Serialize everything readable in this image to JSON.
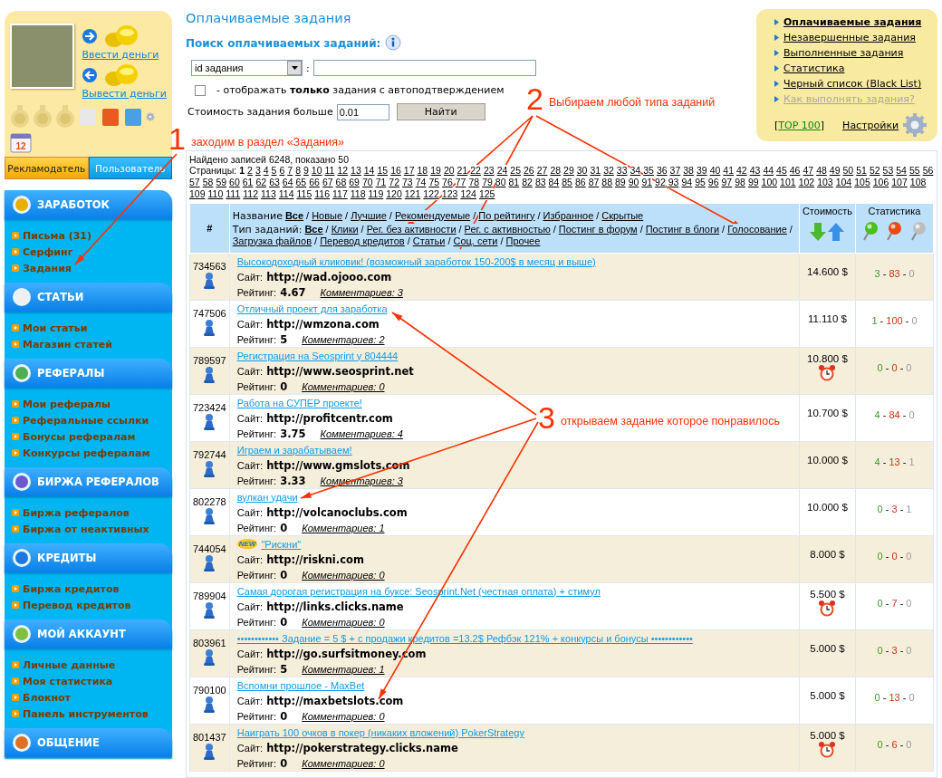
{
  "account": {
    "deposit": "Ввести деньги",
    "withdraw": "Вывести деньги",
    "calendar_day": "12",
    "tabs": [
      {
        "label": "Рекламодатель",
        "selected": false
      },
      {
        "label": "Пользователь",
        "selected": true
      }
    ]
  },
  "sidebar": [
    {
      "title": "ЗАРАБОТОК",
      "items": [
        "Письма (31)",
        "Серфинг",
        "Задания"
      ]
    },
    {
      "title": "СТАТЬИ",
      "items": [
        "Мои статьи",
        "Магазин статей"
      ]
    },
    {
      "title": "РЕФЕРАЛЫ",
      "items": [
        "Мои рефералы",
        "Реферальные ссылки",
        "Бонусы рефералам",
        "Конкурсы рефералам"
      ]
    },
    {
      "title": "БИРЖА РЕФЕРАЛОВ",
      "items": [
        "Биржа рефералов",
        "Биржа от неактивных"
      ]
    },
    {
      "title": "КРЕДИТЫ",
      "items": [
        "Биржа кредитов",
        "Перевод кредитов"
      ]
    },
    {
      "title": "МОЙ АККАУНТ",
      "items": [
        "Личные данные",
        "Моя статистика",
        "Блокнот",
        "Панель инструментов"
      ]
    },
    {
      "title": "ОБЩЕНИЕ"
    }
  ],
  "page_title": "Оплачиваемые задания",
  "search": {
    "title": "Поиск оплачиваемых заданий:",
    "select_value": "id задания",
    "colon": ":",
    "autoconfirm": {
      "label": "- отображать **только** задания с автоподтверждением",
      "checked": false
    },
    "price_label": "Стоимость задания больше",
    "price_value": "0.01",
    "button": "Найти"
  },
  "right_menu": {
    "items": [
      {
        "label": "Оплачиваемые задания",
        "selected": true,
        "kind": "link"
      },
      {
        "label": "Незавершенные задания",
        "selected": false,
        "kind": "link"
      },
      {
        "label": "Выполненные задания",
        "selected": false,
        "kind": "link"
      },
      {
        "label": "Статистика",
        "selected": false,
        "kind": "link"
      },
      {
        "label": "Черный список (Black List)",
        "selected": false,
        "kind": "link"
      },
      {
        "label": "Как выполнять задания?",
        "selected": false,
        "kind": "help"
      }
    ],
    "top_prefix": "[",
    "top_link": "TOP 100",
    "top_suffix": "]",
    "settings": "Настройки"
  },
  "results": {
    "found": "Найдено записей 6248, показано 50",
    "pages_label": "Страницы:",
    "pages": [
      {
        "label": "1",
        "selected": true
      },
      {
        "label": "2",
        "selected": false
      },
      {
        "label": "3",
        "selected": false
      },
      {
        "label": "4",
        "selected": false
      },
      {
        "label": "5",
        "selected": false
      },
      {
        "label": "6",
        "selected": false
      },
      {
        "label": "7",
        "selected": false
      },
      {
        "label": "8",
        "selected": false
      },
      {
        "label": "9",
        "selected": false
      },
      {
        "label": "10",
        "selected": false
      },
      {
        "label": "11",
        "selected": false
      },
      {
        "label": "12",
        "selected": false
      },
      {
        "label": "13",
        "selected": false
      },
      {
        "label": "14",
        "selected": false
      },
      {
        "label": "15",
        "selected": false
      },
      {
        "label": "16",
        "selected": false
      },
      {
        "label": "17",
        "selected": false
      },
      {
        "label": "18",
        "selected": false
      },
      {
        "label": "19",
        "selected": false
      },
      {
        "label": "20",
        "selected": false
      },
      {
        "label": "21",
        "selected": false
      },
      {
        "label": "22",
        "selected": false
      },
      {
        "label": "23",
        "selected": false
      },
      {
        "label": "24",
        "selected": false
      },
      {
        "label": "25",
        "selected": false
      },
      {
        "label": "26",
        "selected": false
      },
      {
        "label": "27",
        "selected": false
      },
      {
        "label": "28",
        "selected": false
      },
      {
        "label": "29",
        "selected": false
      },
      {
        "label": "30",
        "selected": false
      },
      {
        "label": "31",
        "selected": false
      },
      {
        "label": "32",
        "selected": false
      },
      {
        "label": "33",
        "selected": false
      },
      {
        "label": "34",
        "selected": false
      },
      {
        "label": "35",
        "selected": false
      },
      {
        "label": "36",
        "selected": false
      },
      {
        "label": "37",
        "selected": false
      },
      {
        "label": "38",
        "selected": false
      },
      {
        "label": "39",
        "selected": false
      },
      {
        "label": "40",
        "selected": false
      },
      {
        "label": "41",
        "selected": false
      },
      {
        "label": "42",
        "selected": false
      },
      {
        "label": "43",
        "selected": false
      },
      {
        "label": "44",
        "selected": false
      },
      {
        "label": "45",
        "selected": false
      },
      {
        "label": "46",
        "selected": false
      },
      {
        "label": "47",
        "selected": false
      },
      {
        "label": "48",
        "selected": false
      },
      {
        "label": "49",
        "selected": false
      },
      {
        "label": "50",
        "selected": false
      },
      {
        "label": "51",
        "selected": false
      },
      {
        "label": "52",
        "selected": false
      },
      {
        "label": "53",
        "selected": false
      },
      {
        "label": "54",
        "selected": false
      },
      {
        "label": "55",
        "selected": false
      },
      {
        "label": "56",
        "selected": false
      },
      {
        "label": "57",
        "selected": false
      },
      {
        "label": "58",
        "selected": false
      },
      {
        "label": "59",
        "selected": false
      },
      {
        "label": "60",
        "selected": false
      },
      {
        "label": "61",
        "selected": false
      },
      {
        "label": "62",
        "selected": false
      },
      {
        "label": "63",
        "selected": false
      },
      {
        "label": "64",
        "selected": false
      },
      {
        "label": "65",
        "selected": false
      },
      {
        "label": "66",
        "selected": false
      },
      {
        "label": "67",
        "selected": false
      },
      {
        "label": "68",
        "selected": false
      },
      {
        "label": "69",
        "selected": false
      },
      {
        "label": "70",
        "selected": false
      },
      {
        "label": "71",
        "selected": false
      },
      {
        "label": "72",
        "selected": false
      },
      {
        "label": "73",
        "selected": false
      },
      {
        "label": "74",
        "selected": false
      },
      {
        "label": "75",
        "selected": false
      },
      {
        "label": "76",
        "selected": false
      },
      {
        "label": "77",
        "selected": false
      },
      {
        "label": "78",
        "selected": false
      },
      {
        "label": "79",
        "selected": false
      },
      {
        "label": "80",
        "selected": false
      },
      {
        "label": "81",
        "selected": false
      },
      {
        "label": "82",
        "selected": false
      },
      {
        "label": "83",
        "selected": false
      },
      {
        "label": "84",
        "selected": false
      },
      {
        "label": "85",
        "selected": false
      },
      {
        "label": "86",
        "selected": false
      },
      {
        "label": "87",
        "selected": false
      },
      {
        "label": "88",
        "selected": false
      },
      {
        "label": "89",
        "selected": false
      },
      {
        "label": "90",
        "selected": false
      },
      {
        "label": "91",
        "selected": false
      },
      {
        "label": "92",
        "selected": false
      },
      {
        "label": "93",
        "selected": false
      },
      {
        "label": "94",
        "selected": false
      },
      {
        "label": "95",
        "selected": false
      },
      {
        "label": "96",
        "selected": false
      },
      {
        "label": "97",
        "selected": false
      },
      {
        "label": "98",
        "selected": false
      },
      {
        "label": "99",
        "selected": false
      },
      {
        "label": "100",
        "selected": false
      },
      {
        "label": "101",
        "selected": false
      },
      {
        "label": "102",
        "selected": false
      },
      {
        "label": "103",
        "selected": false
      },
      {
        "label": "104",
        "selected": false
      },
      {
        "label": "105",
        "selected": false
      },
      {
        "label": "106",
        "selected": false
      },
      {
        "label": "107",
        "selected": false
      },
      {
        "label": "108",
        "selected": false
      },
      {
        "label": "109",
        "selected": false
      },
      {
        "label": "110",
        "selected": false
      },
      {
        "label": "111",
        "selected": false
      },
      {
        "label": "112",
        "selected": false
      },
      {
        "label": "113",
        "selected": false
      },
      {
        "label": "114",
        "selected": false
      },
      {
        "label": "115",
        "selected": false
      },
      {
        "label": "116",
        "selected": false
      },
      {
        "label": "117",
        "selected": false
      },
      {
        "label": "118",
        "selected": false
      },
      {
        "label": "119",
        "selected": false
      },
      {
        "label": "120",
        "selected": false
      },
      {
        "label": "121",
        "selected": false
      },
      {
        "label": "122",
        "selected": false
      },
      {
        "label": "123",
        "selected": false
      },
      {
        "label": "124",
        "selected": false
      },
      {
        "label": "125",
        "selected": false
      }
    ]
  },
  "table": {
    "id_header": "#",
    "separator": "/",
    "price_header": "Стоимость",
    "stats_header": "Статистика",
    "stats_separator": "-",
    "name_filter": {
      "label": "Название",
      "items": [
        {
          "label": "Все",
          "selected": true
        },
        {
          "label": "Новые",
          "selected": false
        },
        {
          "label": "Лучшие",
          "selected": false
        },
        {
          "label": "Рекомендуемые",
          "selected": false
        },
        {
          "label": "По рейтингу",
          "selected": false
        },
        {
          "label": "Избранное",
          "selected": false
        },
        {
          "label": "Скрытые",
          "selected": false
        }
      ]
    },
    "type_filter": {
      "label": "Тип заданий:",
      "items": [
        {
          "label": "Все",
          "selected": true
        },
        {
          "label": "Клики",
          "selected": false
        },
        {
          "label": "Рег. без активности",
          "selected": false
        },
        {
          "label": "Рег. с активностью",
          "selected": false
        },
        {
          "label": "Постинг в форум",
          "selected": false
        },
        {
          "label": "Постинг в блоги",
          "selected": false
        },
        {
          "label": "Голосование",
          "selected": false
        },
        {
          "label": "Загрузка файлов",
          "selected": false
        },
        {
          "label": "Перевод кредитов",
          "selected": false
        },
        {
          "label": "Статьи",
          "selected": false
        },
        {
          "label": "Соц. сети",
          "selected": false
        },
        {
          "label": "Прочее",
          "selected": false
        }
      ]
    },
    "rows": [
      {
        "id": "734563",
        "title": "Высокодоходный кликовик! (возможный заработок 150-200$ в месяц и выше)",
        "site_label": "Сайт:",
        "site": "http://wad.ojooo.com",
        "rating_label": "Рейтинг:",
        "rating": "4.67",
        "comments": "Комментариев: 3",
        "price": "14.600 $",
        "timer": false,
        "stats": [
          "3",
          "83",
          "0"
        ]
      },
      {
        "id": "747506",
        "title": "Отличный проект для заработка",
        "site_label": "Сайт:",
        "site": "http://wmzona.com",
        "rating_label": "Рейтинг:",
        "rating": "5",
        "comments": "Комментариев: 2",
        "price": "11.110 $",
        "timer": false,
        "stats": [
          "1",
          "100",
          "0"
        ]
      },
      {
        "id": "789597",
        "title": "Регистрация на Seosprint у 804444",
        "site_label": "Сайт:",
        "site": "http://www.seosprint.net",
        "rating_label": "Рейтинг:",
        "rating": "0",
        "comments": "Комментариев: 0",
        "price": "10.800 $",
        "timer": true,
        "stats": [
          "0",
          "0",
          "0"
        ]
      },
      {
        "id": "723424",
        "title": "Работа на СУПЕР проекте!",
        "site_label": "Сайт:",
        "site": "http://profitcentr.com",
        "rating_label": "Рейтинг:",
        "rating": "3.75",
        "comments": "Комментариев: 4",
        "price": "10.700 $",
        "timer": false,
        "stats": [
          "4",
          "84",
          "0"
        ]
      },
      {
        "id": "792744",
        "title": "Играем и зарабатываем!",
        "site_label": "Сайт:",
        "site": "http://www.gmslots.com",
        "rating_label": "Рейтинг:",
        "rating": "3.33",
        "comments": "Комментариев: 3",
        "price": "10.000 $",
        "timer": false,
        "stats": [
          "4",
          "13",
          "1"
        ]
      },
      {
        "id": "802278",
        "title": "вулкан удачи",
        "site_label": "Сайт:",
        "site": "http://volcanoclubs.com",
        "rating_label": "Рейтинг:",
        "rating": "0",
        "comments": "Комментариев: 1",
        "price": "10.000 $",
        "timer": false,
        "stats": [
          "0",
          "3",
          "1"
        ]
      },
      {
        "id": "744054",
        "badge": "NEW",
        "title": "\"Рискни\"",
        "site_label": "Сайт:",
        "site": "http://riskni.com",
        "rating_label": "Рейтинг:",
        "rating": "0",
        "comments": "Комментариев: 0",
        "price": "8.000 $",
        "timer": false,
        "stats": [
          "0",
          "0",
          "0"
        ]
      },
      {
        "id": "789904",
        "title": "Самая дорогая регистрация на буксе: Seosprint.Net (честная оплата) + стимул",
        "site_label": "Сайт:",
        "site": "http://links.clicks.name",
        "rating_label": "Рейтинг:",
        "rating": "0",
        "comments": "Комментариев: 0",
        "price": "5.500 $",
        "timer": true,
        "stats": [
          "0",
          "7",
          "0"
        ]
      },
      {
        "id": "803961",
        "title": "•••••••••••• Задание = 5 $ + с продажи кредитов =13.2$ Рефбэк 121% + конкурсы и бонусы ••••••••••••",
        "site_label": "Сайт:",
        "site": "http://go.surfsitmoney.com",
        "rating_label": "Рейтинг:",
        "rating": "5",
        "comments": "Комментариев: 1",
        "price": "5.000 $",
        "timer": false,
        "stats": [
          "0",
          "3",
          "0"
        ]
      },
      {
        "id": "790100",
        "title": "Вспомни прошлое - MaxBet",
        "site_label": "Сайт:",
        "site": "http://maxbetslots.com",
        "rating_label": "Рейтинг:",
        "rating": "0",
        "comments": "Комментариев: 0",
        "price": "5.000 $",
        "timer": false,
        "stats": [
          "0",
          "13",
          "0"
        ]
      },
      {
        "id": "801437",
        "title": "Наиграть 100 очков в покер (никаких вложений) PokerStrategy",
        "site_label": "Сайт:",
        "site": "http://pokerstrategy.clicks.name",
        "rating_label": "Рейтинг:",
        "rating": "0",
        "comments": "Комментариев: 0",
        "price": "5.000 $",
        "timer": true,
        "stats": [
          "0",
          "6",
          "0"
        ]
      }
    ]
  },
  "annotations": [
    {
      "number": "1",
      "text": "заходим в раздел «Задания»"
    },
    {
      "number": "2",
      "text": "Выбираем любой типа заданий"
    },
    {
      "number": "3",
      "text": "открываем задание которое понравилось"
    }
  ]
}
